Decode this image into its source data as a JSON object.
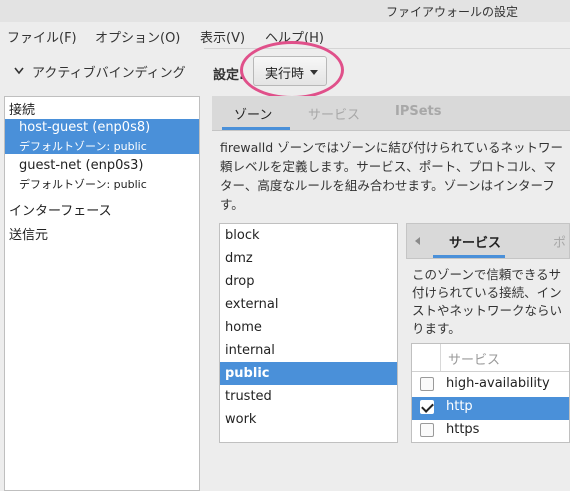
{
  "window": {
    "title": "ファイアウォールの設定"
  },
  "menu": [
    {
      "label": "ファイル(F)"
    },
    {
      "label": "オプション(O)"
    },
    {
      "label": "表示(V)"
    },
    {
      "label": "ヘルプ(H)"
    }
  ],
  "left": {
    "active_bindings": "アクティブバインディング",
    "connections_label": "接続",
    "connections": [
      {
        "name": "host-guest (enp0s8)",
        "zone": "デフォルトゾーン:  public",
        "selected": true
      },
      {
        "name": "guest-net (enp0s3)",
        "zone": "デフォルトゾーン:  public",
        "selected": false
      }
    ],
    "interfaces_label": "インターフェース",
    "sources_label": "送信元"
  },
  "config": {
    "label": "設定:",
    "value": "実行時"
  },
  "tabs": [
    {
      "label": "ゾーン",
      "active": true
    },
    {
      "label": "サービス",
      "active": false
    },
    {
      "label": "IPSets",
      "active": false
    }
  ],
  "zone_description": [
    "firewalld ゾーンではゾーンに結び付けられているネットワー",
    "頼レベルを定義します。サービス、ポート、プロトコル、マ",
    "ター、高度なルールを組み合わせます。ゾーンはインターフ",
    "す。"
  ],
  "zones": [
    "block",
    "dmz",
    "drop",
    "external",
    "home",
    "internal",
    "public",
    "trusted",
    "work"
  ],
  "selected_zone": "public",
  "inner_tabs": [
    {
      "label": "サービス",
      "active": true
    },
    {
      "label": "ポ",
      "active": false
    }
  ],
  "service_description": [
    "このゾーンで信頼できるサ",
    "付けられている接続、イン",
    "ストやネットワークならい",
    "ります。"
  ],
  "services": {
    "header": "サービス",
    "rows": [
      {
        "name": "high-availability",
        "checked": false,
        "selected": false
      },
      {
        "name": "http",
        "checked": true,
        "selected": true
      },
      {
        "name": "https",
        "checked": false,
        "selected": false
      }
    ]
  },
  "colors": {
    "selection": "#4a90d9",
    "highlight_ring": "#e0508a"
  }
}
